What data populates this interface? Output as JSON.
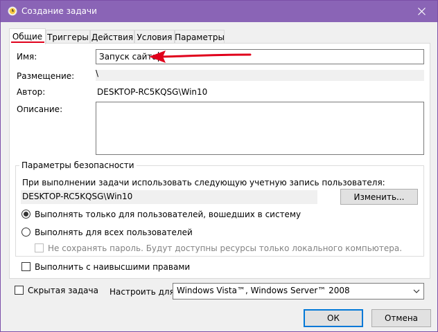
{
  "window": {
    "title": "Создание задачи",
    "close_icon": "close-icon"
  },
  "tabs": [
    {
      "label": "Общие"
    },
    {
      "label": "Триггеры"
    },
    {
      "label": "Действия"
    },
    {
      "label": "Условия"
    },
    {
      "label": "Параметры"
    }
  ],
  "general": {
    "name_label": "Имя:",
    "name_value": "Запуск сайта",
    "location_label": "Размещение:",
    "location_value": "\\",
    "author_label": "Автор:",
    "author_value": "DESKTOP-RC5KQSG\\Win10",
    "description_label": "Описание:",
    "description_value": ""
  },
  "security": {
    "title": "Параметры безопасности",
    "run_as_text": "При выполнении задачи использовать следующую учетную запись пользователя:",
    "account": "DESKTOP-RC5KQSG\\Win10",
    "change_button": "Изменить...",
    "radio_logged_on": "Выполнять только для пользователей, вошедших в систему",
    "radio_logged_on_checked": true,
    "radio_all_users": "Выполнять для всех пользователей",
    "radio_all_users_checked": false,
    "no_store_password": "Не сохранять пароль. Будут доступны ресурсы только локального компьютера.",
    "highest_privileges": "Выполнить с наивысшими правами"
  },
  "footer": {
    "hidden_task": "Скрытая задача",
    "configure_for_label": "Настроить для:",
    "configure_for_value": "Windows Vista™, Windows Server™ 2008",
    "ok_button": "ОК",
    "cancel_button": "Отмена"
  },
  "colors": {
    "titlebar": "#8a64b6",
    "highlight_arrow": "#e0001b",
    "focus_border": "#0078d7"
  }
}
